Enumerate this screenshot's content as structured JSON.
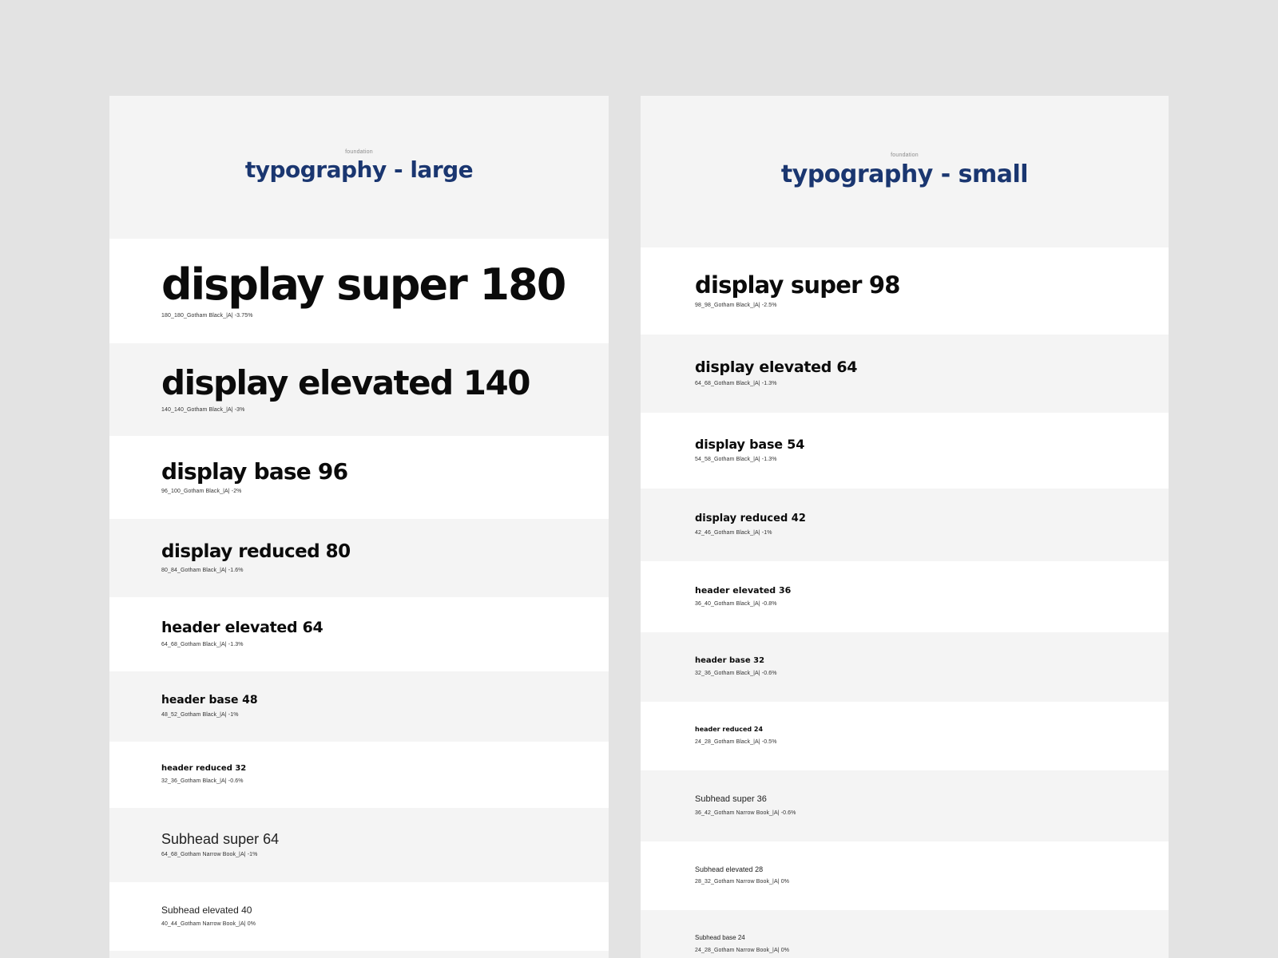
{
  "panels": {
    "large": {
      "eyebrow": "foundation",
      "title": "typography - large",
      "rows": [
        {
          "name": "display super 180",
          "spec": "180_180_Gotham Black_|A| -3.75%"
        },
        {
          "name": "display elevated 140",
          "spec": "140_140_Gotham Black_|A| -3%"
        },
        {
          "name": "display base 96",
          "spec": "96_100_Gotham Black_|A| -2%"
        },
        {
          "name": "display reduced 80",
          "spec": "80_84_Gotham Black_|A| -1.6%"
        },
        {
          "name": "header elevated 64",
          "spec": "64_68_Gotham Black_|A| -1.3%"
        },
        {
          "name": "header base 48",
          "spec": "48_52_Gotham Black_|A| -1%"
        },
        {
          "name": "header reduced 32",
          "spec": "32_36_Gotham Black_|A| -0.6%"
        },
        {
          "name": "Subhead super 64",
          "spec": "64_68_Gotham Narrow Book_|A| -1%"
        },
        {
          "name": "Subhead elevated 40",
          "spec": "40_44_Gotham Narrow Book_|A| 0%"
        }
      ]
    },
    "small": {
      "eyebrow": "foundation",
      "title": "typography - small",
      "rows": [
        {
          "name": "display super 98",
          "spec": "98_98_Gotham Black_|A| -2.5%"
        },
        {
          "name": "display elevated 64",
          "spec": "64_68_Gotham Black_|A| -1.3%"
        },
        {
          "name": "display base 54",
          "spec": "54_58_Gotham Black_|A| -1.3%"
        },
        {
          "name": "display reduced 42",
          "spec": "42_46_Gotham Black_|A| -1%"
        },
        {
          "name": "header elevated 36",
          "spec": "36_40_Gotham Black_|A| -0.8%"
        },
        {
          "name": "header base 32",
          "spec": "32_36_Gotham Black_|A| -0.6%"
        },
        {
          "name": "header reduced 24",
          "spec": "24_28_Gotham Black_|A| -0.5%"
        },
        {
          "name": "Subhead super 36",
          "spec": "36_42_Gotham Narrow Book_|A| -0.6%"
        },
        {
          "name": "Subhead elevated 28",
          "spec": "28_32_Gotham Narrow Book_|A| 0%"
        },
        {
          "name": "Subhead base 24",
          "spec": "24_28_Gotham Narrow Book_|A| 0%"
        }
      ]
    }
  },
  "colors": {
    "page_background": "#e3e3e3",
    "panel_background": "#f4f4f4",
    "row_white": "#ffffff",
    "title_navy": "#1a3670",
    "text_black": "#0b0b0b"
  }
}
